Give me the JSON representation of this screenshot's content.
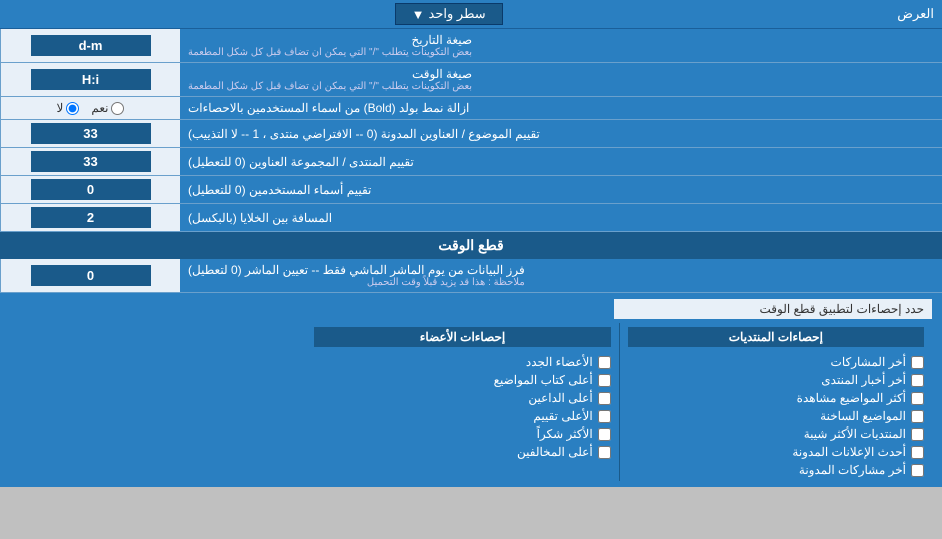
{
  "topBar": {
    "label": "العرض",
    "dropdown": "سطر واحد"
  },
  "rows": [
    {
      "id": "date-format",
      "label": "صيغة التاريخ",
      "sublabel": "بعض التكوينات يتطلب \"/\" التي يمكن ان تضاف قبل كل شكل المطعمة",
      "inputValue": "d-m",
      "inputType": "text"
    },
    {
      "id": "time-format",
      "label": "صيغة الوقت",
      "sublabel": "بعض التكوينات يتطلب \"/\" التي يمكن ان تضاف قبل كل شكل المطعمة",
      "inputValue": "H:i",
      "inputType": "text"
    },
    {
      "id": "bold-remove",
      "label": "ازالة نمط بولد (Bold) من اسماء المستخدمين بالاحصاءات",
      "inputType": "radio",
      "radioOptions": [
        "نعم",
        "لا"
      ],
      "radioSelected": 1
    },
    {
      "id": "topic-order",
      "label": "تقييم الموضوع / العناوين المدونة (0 -- الافتراضي منتدى ، 1 -- لا التذييب)",
      "inputValue": "33",
      "inputType": "text"
    },
    {
      "id": "forum-order",
      "label": "تقييم المنتدى / المجموعة العناوين (0 للتعطيل)",
      "inputValue": "33",
      "inputType": "text"
    },
    {
      "id": "username-order",
      "label": "تقييم أسماء المستخدمين (0 للتعطيل)",
      "inputValue": "0",
      "inputType": "text"
    },
    {
      "id": "gap",
      "label": "المسافة بين الخلايا (بالبكسل)",
      "inputValue": "2",
      "inputType": "text"
    }
  ],
  "cutSection": {
    "header": "قطع الوقت",
    "rowLabel": "فرز البيانات من يوم الماشر الماشي فقط -- تعيين الماشر (0 لتعطيل)",
    "rowNote": "ملاحظة : هذا قد يزيد قبلاً وقت التحميل",
    "inputValue": "0"
  },
  "statsSection": {
    "limitLabel": "حدد إحصاءات لتطبيق قطع الوقت",
    "col1Header": "إحصاءات المنتديات",
    "col2Header": "إحصاءات الأعضاء",
    "col1Items": [
      "أخر المشاركات",
      "أخر أخبار المنتدى",
      "أكثر المواضيع مشاهدة",
      "المواضيع الساخنة",
      "المنتديات الأكثر شيبة",
      "أحدث الإعلانات المدونة",
      "أخر مشاركات المدونة"
    ],
    "col2Items": [
      "الأعضاء الجدد",
      "أعلى كتاب المواضيع",
      "أعلى الداعين",
      "الأعلى تقييم",
      "الأكثر شكراً",
      "أعلى المخالفين"
    ]
  }
}
